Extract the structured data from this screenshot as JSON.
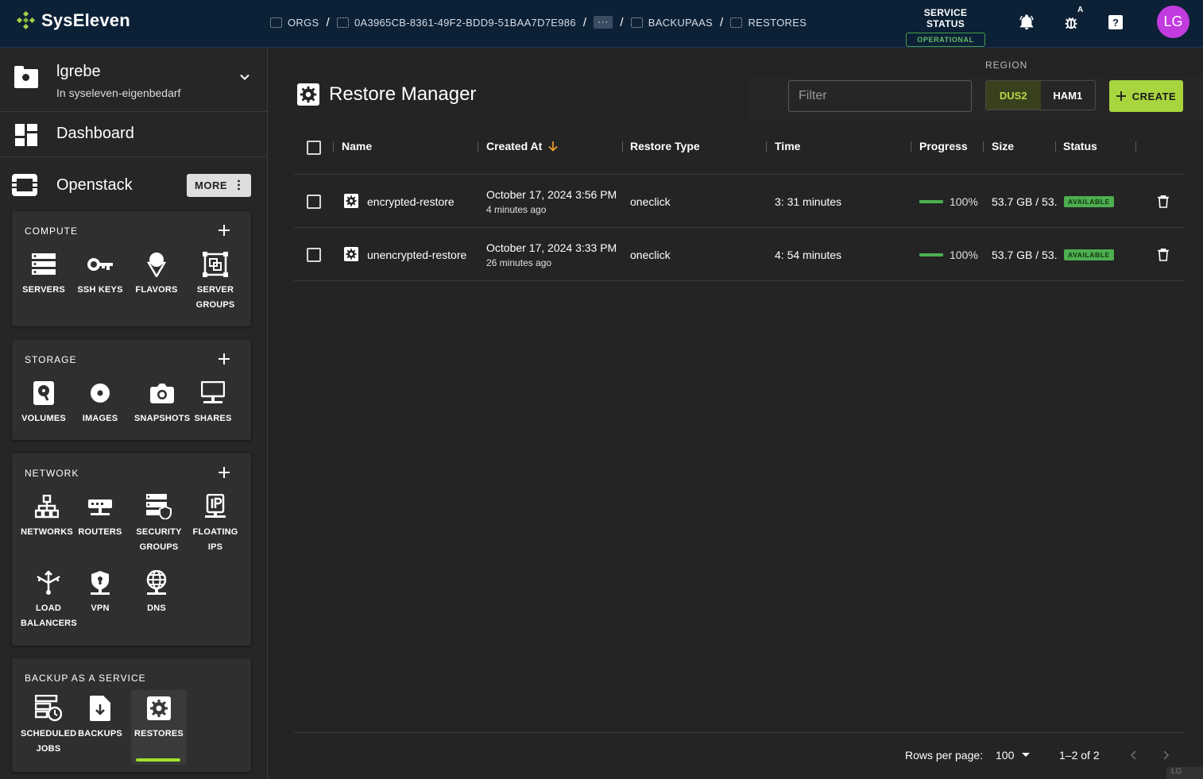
{
  "app": {
    "brand": "SysEleven"
  },
  "breadcrumbs": [
    {
      "label": "ORGS"
    },
    {
      "label": "0A3965CB-8361-49F2-BDD9-51BAA7D7E986"
    },
    {
      "label": "···"
    },
    {
      "label": "BACKUPAAS"
    },
    {
      "label": "RESTORES"
    }
  ],
  "service_status": {
    "title": "SERVICE STATUS",
    "value": "OPERATIONAL"
  },
  "header_icons": {
    "notifications": "bell-icon",
    "debug": "bug-icon",
    "debug_badge": "A",
    "help": "help-icon"
  },
  "user": {
    "initials": "LG",
    "name": "lgrebe",
    "org": "In syseleven-eigenbedarf"
  },
  "nav": {
    "dashboard": "Dashboard",
    "openstack": "Openstack",
    "more": "MORE"
  },
  "sections": {
    "compute": {
      "title": "COMPUTE",
      "items": [
        {
          "l1": "SERVERS",
          "l2": ""
        },
        {
          "l1": "SSH KEYS",
          "l2": ""
        },
        {
          "l1": "FLAVORS",
          "l2": ""
        },
        {
          "l1": "SERVER",
          "l2": "GROUPS"
        }
      ]
    },
    "storage": {
      "title": "STORAGE",
      "items": [
        {
          "l1": "VOLUMES"
        },
        {
          "l1": "IMAGES"
        },
        {
          "l1": "SNAPSHOTS"
        },
        {
          "l1": "SHARES"
        }
      ]
    },
    "network": {
      "title": "NETWORK",
      "items": [
        {
          "l1": "NETWORKS",
          "l2": ""
        },
        {
          "l1": "ROUTERS",
          "l2": ""
        },
        {
          "l1": "SECURITY",
          "l2": "GROUPS"
        },
        {
          "l1": "FLOATING",
          "l2": "IPS"
        },
        {
          "l1": "LOAD",
          "l2": "BALANCERS"
        },
        {
          "l1": "VPN",
          "l2": ""
        },
        {
          "l1": "DNS",
          "l2": ""
        }
      ]
    },
    "backup": {
      "title": "BACKUP AS A SERVICE",
      "items": [
        {
          "l1": "SCHEDULED",
          "l2": "JOBS"
        },
        {
          "l1": "BACKUPS",
          "l2": ""
        },
        {
          "l1": "RESTORES",
          "l2": ""
        }
      ]
    }
  },
  "main": {
    "title": "Restore Manager",
    "region_label": "REGION",
    "filter_placeholder": "Filter",
    "regions": [
      {
        "label": "DUS2",
        "selected": true
      },
      {
        "label": "HAM1",
        "selected": false
      }
    ],
    "create": "CREATE",
    "columns": {
      "name": "Name",
      "created": "Created At",
      "type": "Restore Type",
      "time": "Time",
      "progress": "Progress",
      "size": "Size",
      "status": "Status"
    },
    "rows": [
      {
        "name": "encrypted-restore",
        "created": "October 17, 2024 3:56 PM",
        "created_ago": "4 minutes ago",
        "type": "oneclick",
        "time": "3: 31 minutes",
        "progress": "100%",
        "progress_value": 1.0,
        "size": "53.7 GB / 53.",
        "status": "AVAILABLE"
      },
      {
        "name": "unencrypted-restore",
        "created": "October 17, 2024 3:33 PM",
        "created_ago": "26 minutes ago",
        "type": "oneclick",
        "time": "4: 54 minutes",
        "progress": "100%",
        "progress_value": 1.0,
        "size": "53.7 GB / 53.",
        "status": "AVAILABLE"
      }
    ],
    "footer": {
      "rows_label": "Rows per page:",
      "rows_value": "100",
      "range": "1–2 of 2"
    }
  },
  "watermark": "LG",
  "colors": {
    "accent": "#a8d43e",
    "status_green": "#4caf50",
    "topbar": "#0d2136",
    "avatar": "#c13bdf"
  }
}
